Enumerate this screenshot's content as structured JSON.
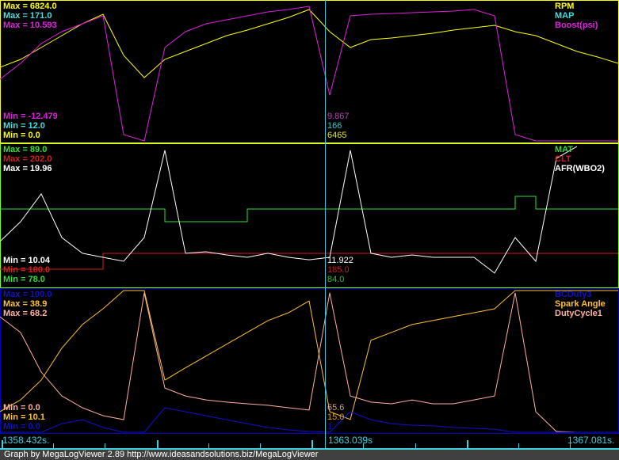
{
  "footer": "Graph by MegaLogViewer 2.89 http://www.ideasandsolutions.biz/MegaLogViewer",
  "time_axis": {
    "start": "1358.432s.",
    "cursor": "1363.039s",
    "end": "1367.081s."
  },
  "panels": [
    {
      "border_color": "#ffff00",
      "max_labels": [
        {
          "text": "Max = 6824.0",
          "color": "#ffff00"
        },
        {
          "text": "Max = 171.0",
          "color": "#40e0e0"
        },
        {
          "text": "Max = 10.593",
          "color": "#e020e0"
        }
      ],
      "min_labels": [
        {
          "text": "Min = -12.479",
          "color": "#e020e0"
        },
        {
          "text": "Min = 12.0",
          "color": "#40e0e0"
        },
        {
          "text": "Min = 0.0",
          "color": "#ffff00"
        }
      ],
      "legend": [
        {
          "text": "RPM",
          "color": "#ffff00"
        },
        {
          "text": "MAP",
          "color": "#40e0e0"
        },
        {
          "text": "Boost(psi)",
          "color": "#e020e0"
        }
      ],
      "cursor_values": [
        {
          "text": "9.867",
          "color": "#c040c0"
        },
        {
          "text": "166",
          "color": "#40c0c0"
        },
        {
          "text": "6465",
          "color": "#e0e040"
        }
      ]
    },
    {
      "border_color": "#80ff00",
      "max_labels": [
        {
          "text": "Max = 89.0",
          "color": "#30e030"
        },
        {
          "text": "Max = 202.0",
          "color": "#d02020"
        },
        {
          "text": "Max = 19.96",
          "color": "#ffffff"
        }
      ],
      "min_labels": [
        {
          "text": "Min = 10.04",
          "color": "#ffffff"
        },
        {
          "text": "Min = 180.0",
          "color": "#d02020"
        },
        {
          "text": "Min = 78.0",
          "color": "#30e030"
        }
      ],
      "legend": [
        {
          "text": "MAT",
          "color": "#30e030"
        },
        {
          "text": "CLT",
          "color": "#d02020"
        },
        {
          "text": "AFR(WBO2)",
          "color": "#ffffff"
        }
      ],
      "cursor_values": [
        {
          "text": "11.922",
          "color": "#ffffff"
        },
        {
          "text": "185.0",
          "color": "#c02020"
        },
        {
          "text": "84.0",
          "color": "#30c030"
        }
      ]
    },
    {
      "border_color": "#0000c0",
      "max_labels": [
        {
          "text": "Max = 100.0",
          "color": "#1010d0"
        },
        {
          "text": "Max = 38.9",
          "color": "#ffc030"
        },
        {
          "text": "Max = 68.2",
          "color": "#ffb0a0"
        }
      ],
      "min_labels": [
        {
          "text": "Min = 0.0",
          "color": "#ffb0a0"
        },
        {
          "text": "Min = 10.1",
          "color": "#ffc030"
        },
        {
          "text": "Min = 0.0",
          "color": "#1010d0"
        }
      ],
      "legend": [
        {
          "text": "BCDuty3",
          "color": "#1010d0"
        },
        {
          "text": "Spark Angle",
          "color": "#ffc030"
        },
        {
          "text": "DutyCycle1",
          "color": "#ffb0a0"
        }
      ],
      "cursor_values": [
        {
          "text": "65.6",
          "color": "#d0a090"
        },
        {
          "text": "15.0",
          "color": "#e0a020"
        },
        {
          "text": "1",
          "color": "#1010c0"
        }
      ]
    }
  ],
  "chart_data": {
    "type": "line",
    "x_note": "31 samples evenly spaced from 1358.432 s to 1367.081 s",
    "series": [
      {
        "panel": 0,
        "name": "RPM",
        "color": "#ffff00",
        "min": 0,
        "max": 6824,
        "values": [
          3626,
          4016,
          4601,
          5186,
          5771,
          6239,
          4211,
          3119,
          4016,
          4406,
          4796,
          5186,
          5459,
          5771,
          6083,
          6473,
          5381,
          4601,
          4991,
          5069,
          5186,
          5303,
          5459,
          5576,
          5693,
          5381,
          5186,
          4796,
          4406,
          4133,
          3821
        ]
      },
      {
        "panel": 0,
        "name": "Boost(psi)",
        "color": "#e020e0",
        "min": -12.479,
        "max": 10.593,
        "values": [
          -2.19,
          0.44,
          3.74,
          5.71,
          7.03,
          8.35,
          -11.42,
          -12.48,
          3.08,
          5.71,
          7.03,
          7.69,
          8.35,
          9.01,
          9.41,
          9.93,
          -4.83,
          8.35,
          8.61,
          8.74,
          8.88,
          9.01,
          9.14,
          9.41,
          8.35,
          -11.42,
          -12.48,
          -12.48,
          -12.48,
          -12.48,
          -12.48
        ]
      },
      {
        "panel": 1,
        "name": "MAT",
        "color": "#30e030",
        "min": 78,
        "max": 89,
        "step": true,
        "values": [
          84,
          84,
          84,
          84,
          84,
          84,
          84,
          84,
          83,
          83,
          83,
          83,
          84,
          84,
          84,
          84,
          84,
          84,
          84,
          84,
          84,
          84,
          84,
          84,
          84,
          85,
          84,
          84,
          84,
          84,
          84
        ]
      },
      {
        "panel": 1,
        "name": "CLT",
        "color": "#d02020",
        "min": 180,
        "max": 202,
        "step": true,
        "values": [
          182.5,
          182.5,
          182.5,
          182.5,
          182.5,
          185,
          185,
          185,
          185,
          185,
          185,
          185,
          185,
          185,
          185,
          185,
          185,
          185,
          185,
          185,
          185,
          185,
          185,
          185,
          185,
          185,
          185,
          185,
          185,
          185,
          185
        ]
      },
      {
        "panel": 1,
        "name": "AFR(WBO2)",
        "color": "#ffffff",
        "min": 10.04,
        "max": 19.96,
        "values": [
          13.14,
          14.55,
          16.53,
          13.42,
          12.3,
          12.01,
          11.73,
          13.42,
          19.63,
          12.3,
          12.41,
          12.18,
          12.01,
          12.3,
          12.01,
          11.84,
          12.01,
          19.63,
          12.3,
          12.01,
          12.18,
          12.01,
          12.01,
          12.01,
          10.89,
          13.42,
          11.73,
          19.06,
          19.91,
          null,
          null
        ]
      },
      {
        "panel": 2,
        "name": "DutyCycle1",
        "color": "#ffb0a0",
        "min": 0,
        "max": 68.2,
        "values": [
          55.6,
          48.0,
          29.0,
          17.5,
          11.8,
          8.0,
          6.1,
          67.1,
          21.3,
          17.5,
          15.6,
          14.5,
          13.7,
          13.0,
          11.8,
          10.7,
          67.1,
          17.5,
          14.5,
          13.7,
          15.6,
          13.7,
          13.7,
          15.6,
          17.5,
          67.1,
          9.9,
          0.4,
          0,
          0,
          0
        ]
      },
      {
        "panel": 2,
        "name": "Spark Angle",
        "color": "#ffc030",
        "min": 10.1,
        "max": 38.9,
        "values": [
          14.3,
          16.7,
          20.7,
          27.2,
          32.0,
          35.2,
          38.9,
          38.9,
          20.7,
          23.2,
          25.6,
          28.0,
          30.4,
          32.8,
          34.4,
          36.8,
          14.3,
          12.7,
          28.8,
          30.4,
          32.0,
          32.8,
          33.6,
          34.4,
          35.2,
          38.9,
          38.9,
          38.9,
          38.9,
          38.9,
          38.9
        ]
      },
      {
        "panel": 2,
        "name": "BCDuty3",
        "color": "#1010d0",
        "min": 0,
        "max": 100,
        "values": [
          0,
          0,
          0,
          6.1,
          8.9,
          3.4,
          0,
          0,
          17.3,
          14.5,
          11.7,
          8.9,
          6.1,
          3.4,
          1.7,
          0.6,
          0,
          14.5,
          8.9,
          6.1,
          5.0,
          4.5,
          3.4,
          2.8,
          2.2,
          0,
          0,
          0,
          0,
          0,
          0
        ]
      }
    ]
  }
}
